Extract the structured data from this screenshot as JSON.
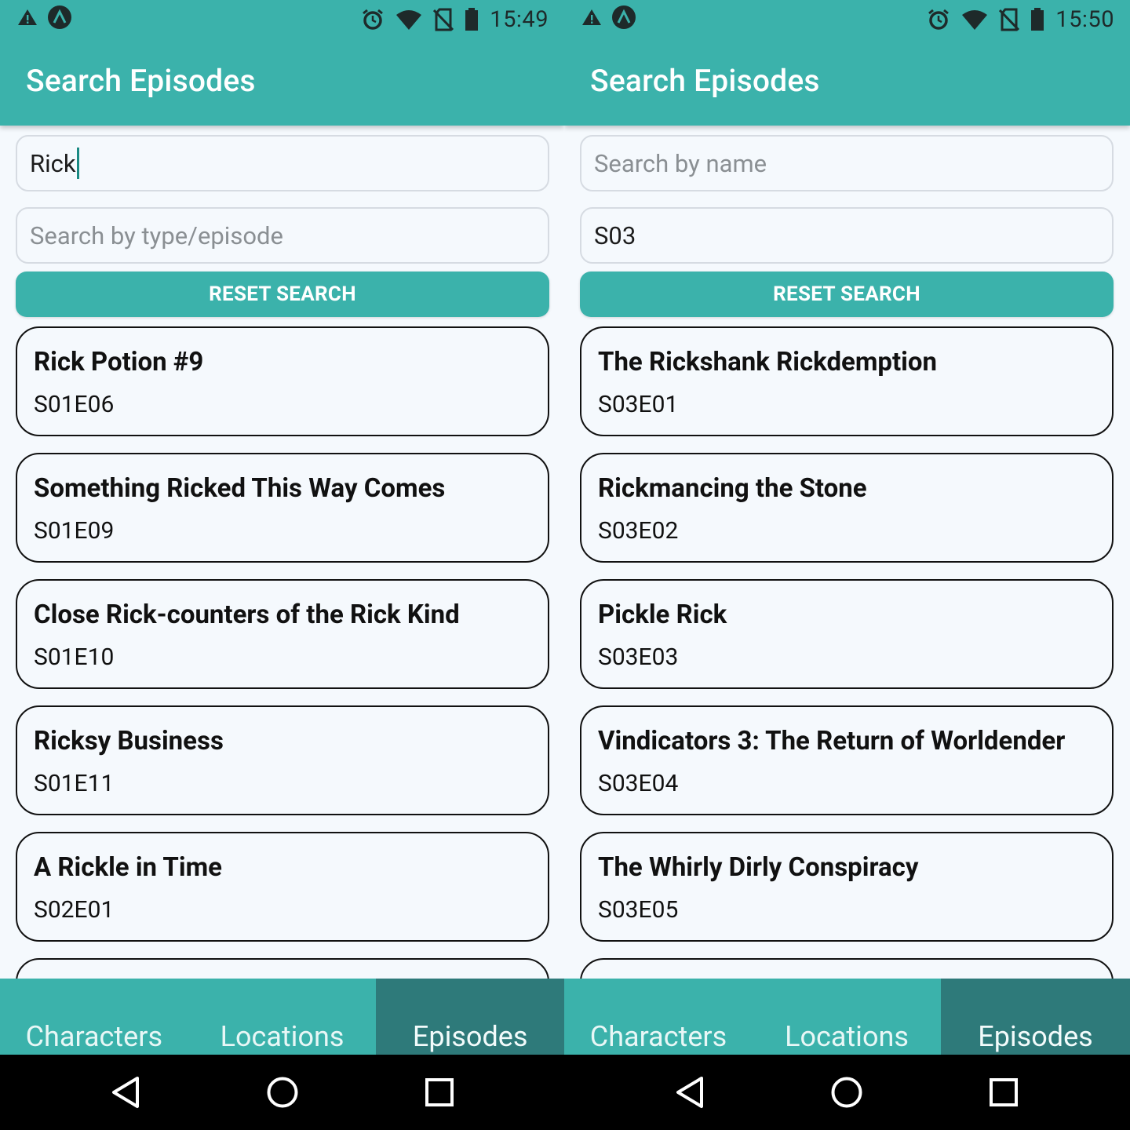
{
  "screens": [
    {
      "status": {
        "time": "15:49"
      },
      "title": "Search Episodes",
      "name_search": {
        "value": "Rick",
        "placeholder": "Search by name"
      },
      "type_search": {
        "value": "",
        "placeholder": "Search by type/episode"
      },
      "reset_label": "RESET SEARCH",
      "episodes": [
        {
          "name": "Rick Potion #9",
          "code": "S01E06"
        },
        {
          "name": "Something Ricked This Way Comes",
          "code": "S01E09"
        },
        {
          "name": "Close Rick-counters of the Rick Kind",
          "code": "S01E10"
        },
        {
          "name": "Ricksy Business",
          "code": "S01E11"
        },
        {
          "name": "A Rickle in Time",
          "code": "S02E01"
        }
      ],
      "nav": [
        "Characters",
        "Locations",
        "Episodes"
      ],
      "active_tab": "Episodes"
    },
    {
      "status": {
        "time": "15:50"
      },
      "title": "Search Episodes",
      "name_search": {
        "value": "",
        "placeholder": "Search by name"
      },
      "type_search": {
        "value": "S03",
        "placeholder": "Search by type/episode"
      },
      "reset_label": "RESET SEARCH",
      "episodes": [
        {
          "name": "The Rickshank Rickdemption",
          "code": "S03E01"
        },
        {
          "name": "Rickmancing the Stone",
          "code": "S03E02"
        },
        {
          "name": "Pickle Rick",
          "code": "S03E03"
        },
        {
          "name": "Vindicators 3: The Return of Worldender",
          "code": "S03E04"
        },
        {
          "name": "The Whirly Dirly Conspiracy",
          "code": "S03E05"
        }
      ],
      "nav": [
        "Characters",
        "Locations",
        "Episodes"
      ],
      "active_tab": "Episodes"
    }
  ],
  "status_icons": [
    "warning-icon",
    "app-logo-icon",
    "alarm-icon",
    "wifi-icon",
    "no-sim-icon",
    "battery-icon"
  ],
  "system_nav": [
    "back-icon",
    "home-icon",
    "recents-icon"
  ],
  "colors": {
    "primary": "#3bb2ab",
    "active_tab": "#2e7a7a",
    "background": "#f5f9fd",
    "card_border": "#111111"
  }
}
